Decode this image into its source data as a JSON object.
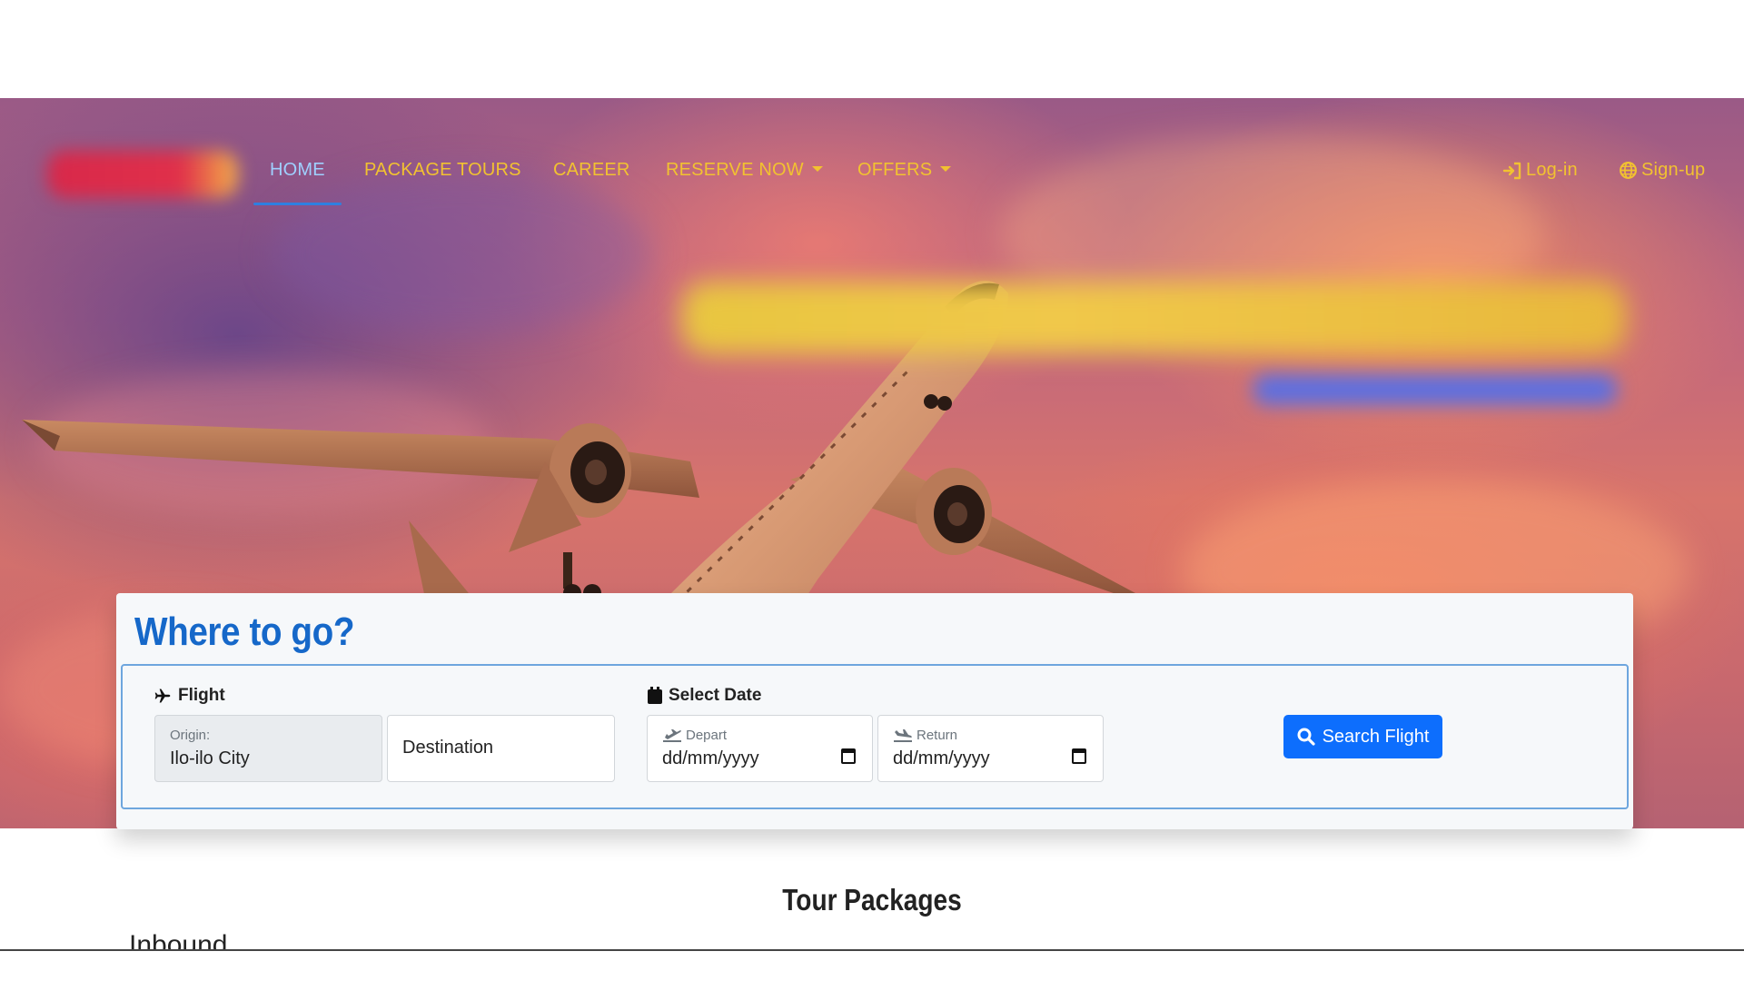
{
  "nav": {
    "items": [
      {
        "label": "HOME",
        "active": true
      },
      {
        "label": "PACKAGE TOURS"
      },
      {
        "label": "CAREER"
      },
      {
        "label": "RESERVE NOW",
        "dropdown": true
      },
      {
        "label": "OFFERS",
        "dropdown": true
      }
    ],
    "login_label": "Log-in",
    "signup_label": "Sign-up"
  },
  "search": {
    "title": "Where to go?",
    "flight_label": "Flight",
    "date_label": "Select Date",
    "origin": {
      "label": "Origin:",
      "value": "Ilo-ilo City"
    },
    "destination": {
      "placeholder": "Destination"
    },
    "depart": {
      "label": "Depart",
      "value": "dd/mm/yyyy"
    },
    "return": {
      "label": "Return",
      "value": "dd/mm/yyyy"
    },
    "button_label": "Search Flight"
  },
  "tours": {
    "title": "Tour Packages",
    "section": "Inbound"
  },
  "colors": {
    "nav_text": "#f2c230",
    "nav_active": "#9fd0ff",
    "title_blue": "#1668c9",
    "button_blue": "#0d6efd"
  }
}
